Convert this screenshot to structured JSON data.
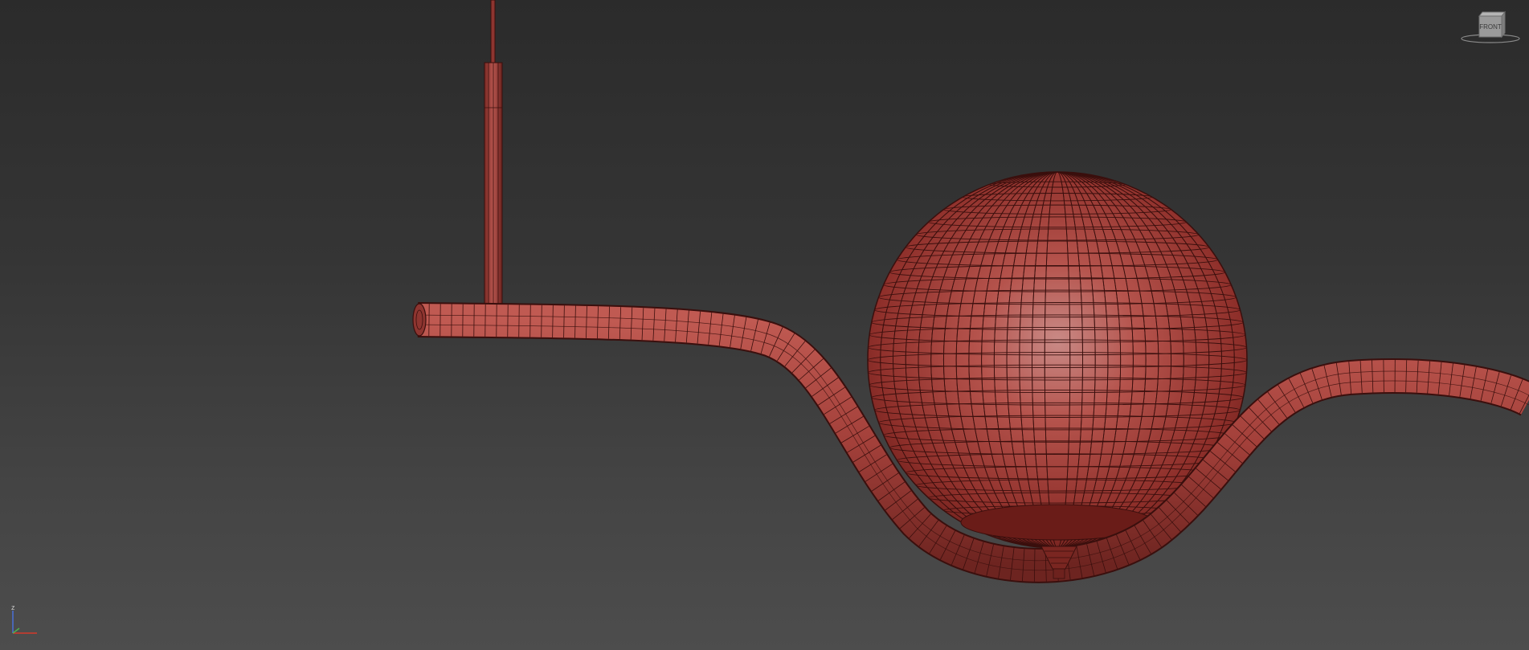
{
  "viewport": {
    "background_top": "#2b2b2b",
    "background_bottom": "#4d4d4d",
    "mesh_color": "#b44a44",
    "wire_color": "#3a0f0d"
  },
  "viewcube": {
    "face_label": "FRONT",
    "icon": "viewcube-icon"
  },
  "axis_tripod": {
    "z_label": "z",
    "x_color": "#d33a2a",
    "y_color": "#4fb04f",
    "z_color": "#4a6fd8",
    "icon": "axis-tripod-icon"
  }
}
